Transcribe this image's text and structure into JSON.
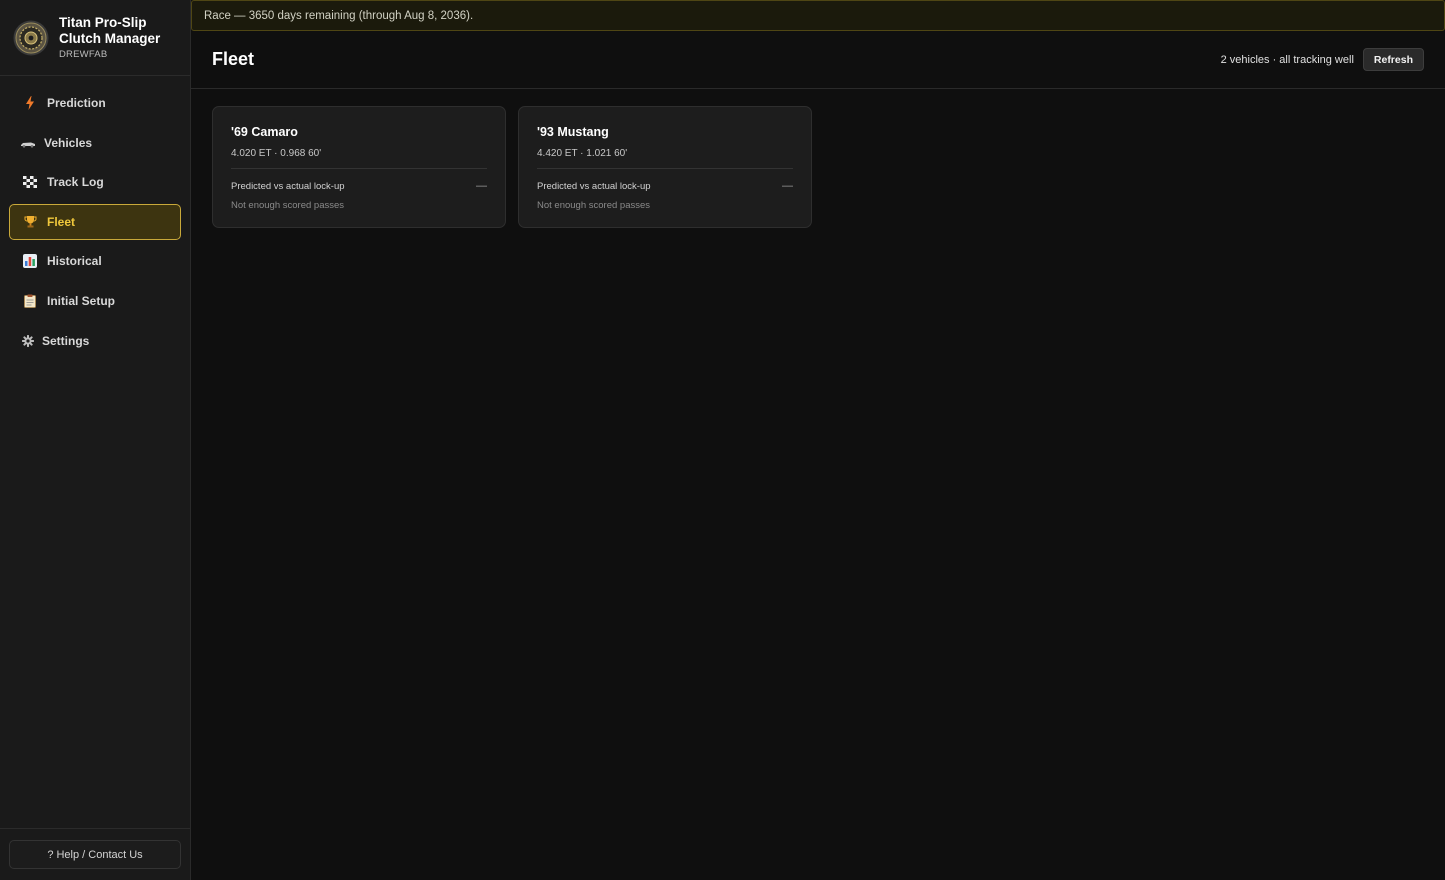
{
  "app": {
    "title": "Titan Pro-Slip Clutch Manager",
    "subtitle": "DREWFAB"
  },
  "colors": {
    "accent": "#f0c83c",
    "active_bg": "#3d3410",
    "banner_border": "#4f4614"
  },
  "sidebar": {
    "items": [
      {
        "label": "Prediction",
        "icon": "lightning-icon",
        "active": false
      },
      {
        "label": "Vehicles",
        "icon": "car-icon",
        "active": false
      },
      {
        "label": "Track Log",
        "icon": "checkered-flag-icon",
        "active": false
      },
      {
        "label": "Fleet",
        "icon": "trophy-icon",
        "active": true
      },
      {
        "label": "Historical",
        "icon": "bar-chart-icon",
        "active": false
      },
      {
        "label": "Initial Setup",
        "icon": "clipboard-icon",
        "active": false
      },
      {
        "label": "Settings",
        "icon": "gear-icon",
        "active": false
      }
    ],
    "help_label": "? Help / Contact Us"
  },
  "banner": {
    "text": "Race — 3650 days remaining (through Aug 8, 2036)."
  },
  "header": {
    "title": "Fleet",
    "status": "2 vehicles · all tracking well",
    "refresh_label": "Refresh"
  },
  "vehicles": [
    {
      "name": "'69 Camaro",
      "stats": "4.020 ET · 0.968 60'",
      "metric_label": "Predicted vs actual lock-up",
      "metric_value": "—",
      "note": "Not enough scored passes"
    },
    {
      "name": "'93 Mustang",
      "stats": "4.420 ET · 1.021 60'",
      "metric_label": "Predicted vs actual lock-up",
      "metric_value": "—",
      "note": "Not enough scored passes"
    }
  ]
}
